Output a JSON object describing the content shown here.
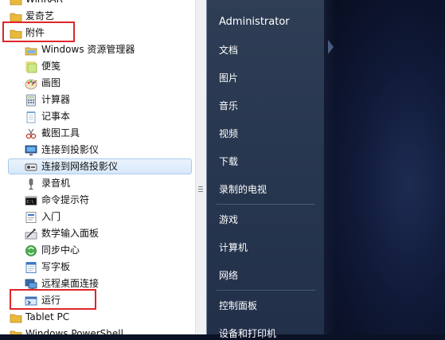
{
  "programs": {
    "items": [
      {
        "label": "WinRAR",
        "icon": "folder-icon",
        "type": "folder"
      },
      {
        "label": "爱奇艺",
        "icon": "folder-icon",
        "type": "folder"
      },
      {
        "label": "附件",
        "icon": "folder-icon",
        "type": "folder"
      },
      {
        "label": "Windows 资源管理器",
        "icon": "explorer-icon",
        "type": "child"
      },
      {
        "label": "便笺",
        "icon": "sticky-notes-icon",
        "type": "child"
      },
      {
        "label": "画图",
        "icon": "paint-icon",
        "type": "child"
      },
      {
        "label": "计算器",
        "icon": "calculator-icon",
        "type": "child"
      },
      {
        "label": "记事本",
        "icon": "notepad-icon",
        "type": "child"
      },
      {
        "label": "截图工具",
        "icon": "snipping-tool-icon",
        "type": "child"
      },
      {
        "label": "连接到投影仪",
        "icon": "projector-icon",
        "type": "child"
      },
      {
        "label": "连接到网络投影仪",
        "icon": "network-projector-icon",
        "type": "child"
      },
      {
        "label": "录音机",
        "icon": "microphone-icon",
        "type": "child"
      },
      {
        "label": "命令提示符",
        "icon": "command-prompt-icon",
        "type": "child"
      },
      {
        "label": "入门",
        "icon": "getting-started-icon",
        "type": "child"
      },
      {
        "label": "数学输入面板",
        "icon": "math-input-icon",
        "type": "child"
      },
      {
        "label": "同步中心",
        "icon": "sync-center-icon",
        "type": "child"
      },
      {
        "label": "写字板",
        "icon": "wordpad-icon",
        "type": "child"
      },
      {
        "label": "远程桌面连接",
        "icon": "remote-desktop-icon",
        "type": "child"
      },
      {
        "label": "运行",
        "icon": "run-icon",
        "type": "child"
      },
      {
        "label": "Tablet PC",
        "icon": "folder-icon",
        "type": "folder"
      },
      {
        "label": "Windows PowerShell",
        "icon": "folder-icon",
        "type": "folder"
      }
    ]
  },
  "places": {
    "user": "Administrator",
    "documents": "文档",
    "pictures": "图片",
    "music": "音乐",
    "videos": "视频",
    "downloads": "下载",
    "recorded_tv": "录制的电视",
    "games": "游戏",
    "computer": "计算机",
    "network": "网络",
    "control_panel": "控制面板",
    "devices_printers": "设备和打印机"
  },
  "colors": {
    "highlight_box": "#e0262a",
    "places_bg": "#283750",
    "selection_border": "#a9c9ec"
  }
}
